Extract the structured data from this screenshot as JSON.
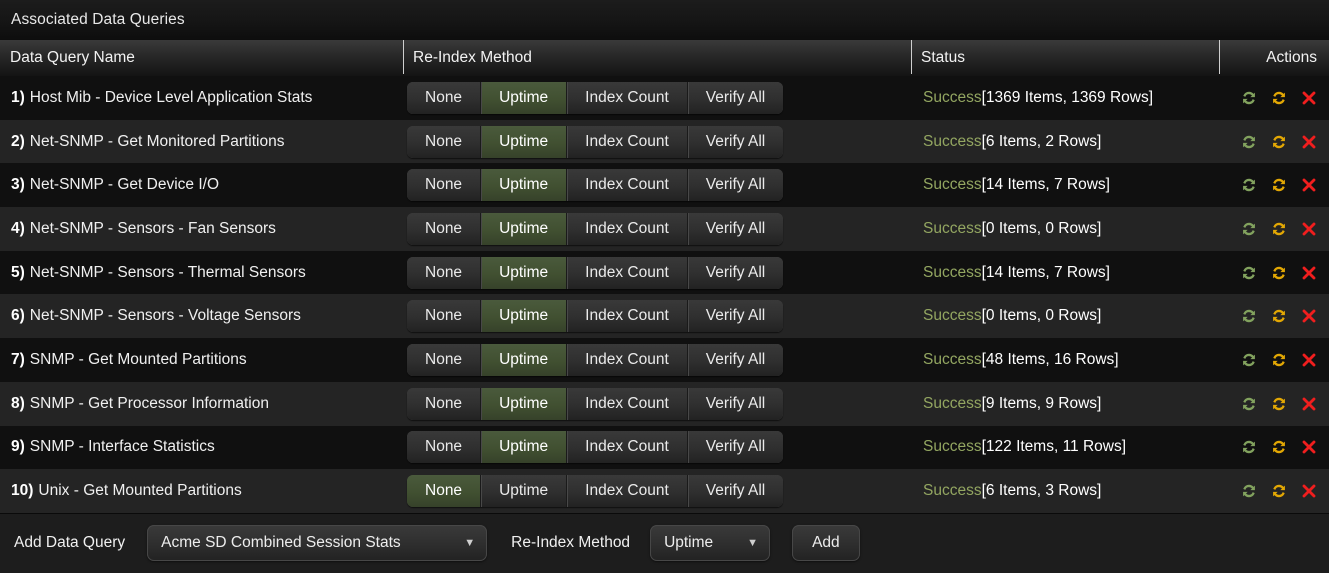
{
  "panel": {
    "title": "Associated Data Queries"
  },
  "table": {
    "columns": [
      {
        "key": "name",
        "label": "Data Query Name"
      },
      {
        "key": "method",
        "label": "Re-Index Method"
      },
      {
        "key": "status",
        "label": "Status"
      },
      {
        "key": "actions",
        "label": "Actions"
      }
    ],
    "method_options": [
      "None",
      "Uptime",
      "Index Count",
      "Verify All"
    ],
    "rows": [
      {
        "num": "1)",
        "name": "Host Mib - Device Level Application Stats",
        "selected_method": "Uptime",
        "status_label": "Success",
        "status_detail": "[1369 Items, 1369 Rows]"
      },
      {
        "num": "2)",
        "name": "Net-SNMP - Get Monitored Partitions",
        "selected_method": "Uptime",
        "status_label": "Success",
        "status_detail": "[6 Items, 2 Rows]"
      },
      {
        "num": "3)",
        "name": "Net-SNMP - Get Device I/O",
        "selected_method": "Uptime",
        "status_label": "Success",
        "status_detail": "[14 Items, 7 Rows]"
      },
      {
        "num": "4)",
        "name": "Net-SNMP - Sensors - Fan Sensors",
        "selected_method": "Uptime",
        "status_label": "Success",
        "status_detail": "[0 Items, 0 Rows]"
      },
      {
        "num": "5)",
        "name": "Net-SNMP - Sensors - Thermal Sensors",
        "selected_method": "Uptime",
        "status_label": "Success",
        "status_detail": "[14 Items, 7 Rows]"
      },
      {
        "num": "6)",
        "name": "Net-SNMP - Sensors - Voltage Sensors",
        "selected_method": "Uptime",
        "status_label": "Success",
        "status_detail": "[0 Items, 0 Rows]"
      },
      {
        "num": "7)",
        "name": "SNMP - Get Mounted Partitions",
        "selected_method": "Uptime",
        "status_label": "Success",
        "status_detail": "[48 Items, 16 Rows]"
      },
      {
        "num": "8)",
        "name": "SNMP - Get Processor Information",
        "selected_method": "Uptime",
        "status_label": "Success",
        "status_detail": "[9 Items, 9 Rows]"
      },
      {
        "num": "9)",
        "name": "SNMP - Interface Statistics",
        "selected_method": "Uptime",
        "status_label": "Success",
        "status_detail": "[122 Items, 11 Rows]"
      },
      {
        "num": "10)",
        "name": "Unix - Get Mounted Partitions",
        "selected_method": "None",
        "status_label": "Success",
        "status_detail": "[6 Items, 3 Rows]"
      }
    ],
    "row_actions": [
      {
        "icon": "reload-green-icon",
        "title": "Reload Data Query"
      },
      {
        "icon": "reload-orange-icon",
        "title": "Re-Index Data Query"
      },
      {
        "icon": "remove-x-icon",
        "title": "Remove Data Query"
      }
    ]
  },
  "toolbar": {
    "add_data_query_label": "Add Data Query",
    "data_query_select": {
      "value": "Acme SD Combined Session Stats",
      "caret": "▼"
    },
    "reindex_method_label": "Re-Index Method",
    "reindex_method_select": {
      "value": "Uptime",
      "caret": "▼"
    },
    "add_button_label": "Add"
  },
  "colors": {
    "selected_green": "#415031",
    "status_success": "#93a661",
    "icon_green": "#82a25e",
    "icon_orange": "#e2a704",
    "icon_red": "#f01e1e",
    "panel_bg": "#111111",
    "row_odd": "#101010",
    "row_even": "#242424"
  }
}
